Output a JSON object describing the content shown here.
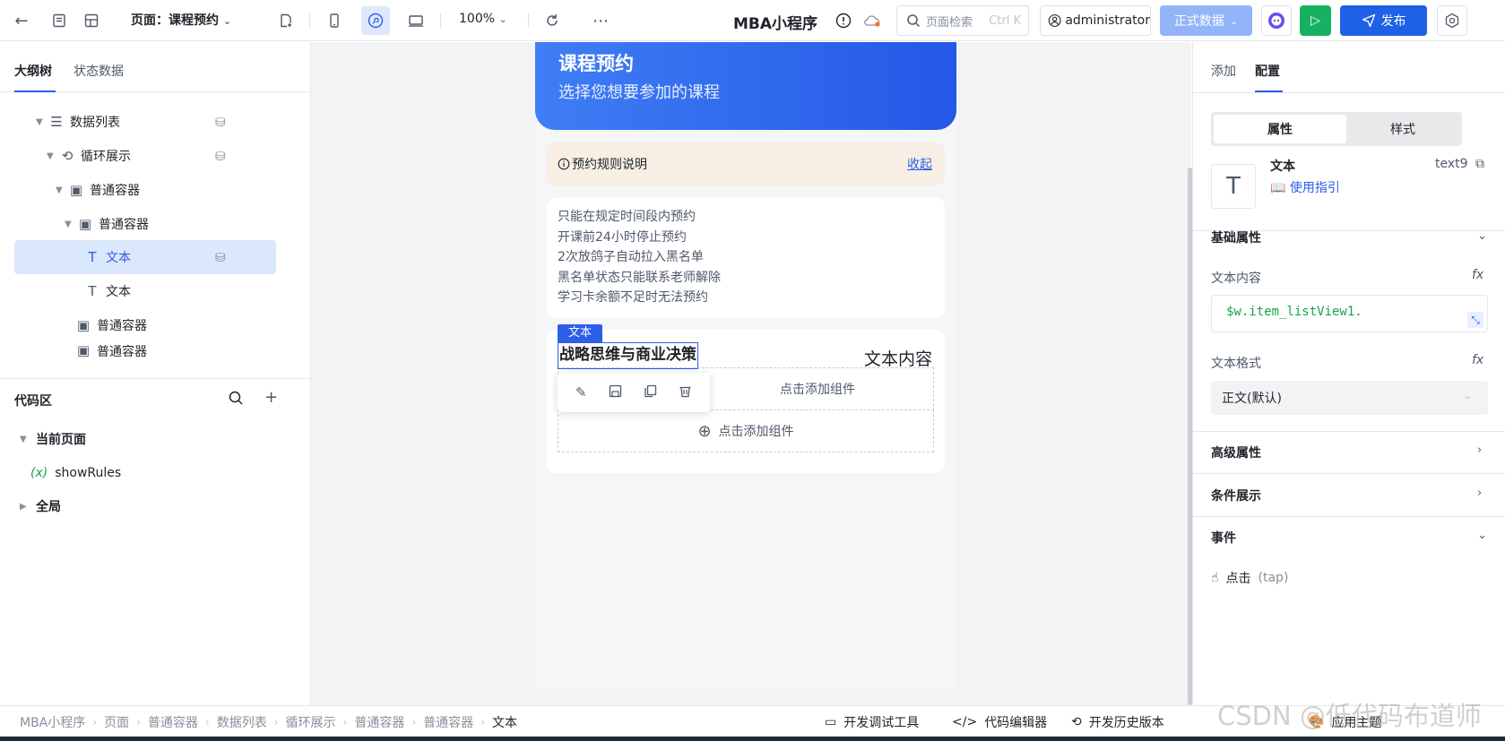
{
  "topbar": {
    "page_label": "页面：课程预约",
    "zoom": "100%",
    "app_title": "MBA小程序",
    "search_placeholder": "页面检索",
    "search_shortcut": "Ctrl K",
    "user": "administrator",
    "data_env": "正式数据",
    "publish": "发布"
  },
  "left": {
    "tabs": [
      "大纲树",
      "状态数据"
    ],
    "tree": [
      {
        "label": "数据列表",
        "icon": "list-icon"
      },
      {
        "label": "循环展示",
        "icon": "loop-icon"
      },
      {
        "label": "普通容器",
        "icon": "container-icon"
      },
      {
        "label": "普通容器",
        "icon": "container-icon"
      },
      {
        "label": "文本",
        "icon": "text-icon",
        "selected": true
      },
      {
        "label": "文本",
        "icon": "text-icon"
      },
      {
        "label": "普通容器",
        "icon": "container-icon"
      },
      {
        "label": "普通容器",
        "icon": "container-icon"
      }
    ],
    "code": {
      "title": "代码区",
      "current_page": "当前页面",
      "var": "showRules",
      "global": "全局"
    }
  },
  "canvas": {
    "hero_title": "课程预约",
    "hero_sub": "选择您想要参加的课程",
    "rules_label": "预约规则说明",
    "rules_collapse": "收起",
    "rules": [
      "只能在规定时间段内预约",
      "开课前24小时停止预约",
      "2次放鸽子自动拉入黑名单",
      "黑名单状态只能联系老师解除",
      "学习卡余额不足时无法预约"
    ],
    "selected_tag": "文本",
    "course_name": "战略思维与商业决策",
    "text_content": "文本内容",
    "add_component": "点击添加组件"
  },
  "right": {
    "tabs": [
      "添加",
      "配置"
    ],
    "seg": [
      "属性",
      "样式"
    ],
    "comp_name": "文本",
    "comp_guide": "使用指引",
    "comp_id": "text9",
    "basic": "基础属性",
    "text_content_label": "文本内容",
    "expr": "$w.item_listView1.",
    "text_format_label": "文本格式",
    "text_format_value": "正文(默认)",
    "advanced": "高级属性",
    "condition": "条件展示",
    "events": "事件",
    "event_click": "点击",
    "event_tap": "(tap)"
  },
  "bottom": {
    "breadcrumb": [
      "MBA小程序",
      "页面",
      "普通容器",
      "数据列表",
      "循环展示",
      "普通容器",
      "普通容器",
      "文本"
    ],
    "tools": [
      "开发调试工具",
      "代码编辑器",
      "开发历史版本",
      "应用主题"
    ],
    "watermark": "CSDN @低代码布道师"
  }
}
